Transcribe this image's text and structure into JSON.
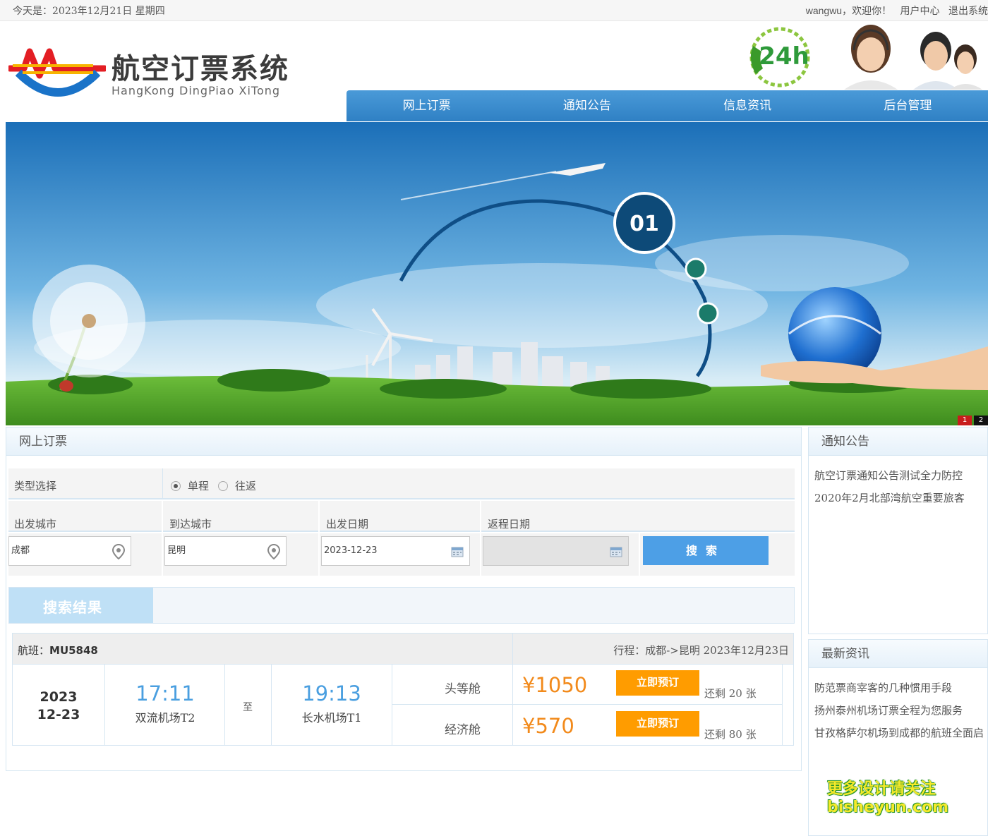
{
  "topbar": {
    "date_text": "今天是：2023年12月21日 星期四",
    "username": "wangwu，",
    "welcome": "欢迎你！",
    "user_center": "用户中心",
    "logout": "退出系统"
  },
  "brand": {
    "title": "航空订票系统",
    "subtitle": "HangKong DingPiao XiTong",
    "badge_text": "24h"
  },
  "nav": {
    "items": [
      "网上订票",
      "通知公告",
      "信息资讯",
      "后台管理"
    ]
  },
  "banner": {
    "slide_label": "01",
    "pager": [
      "1",
      "2"
    ]
  },
  "booking": {
    "panel_title": "网上订票",
    "type_label": "类型选择",
    "trip_types": [
      {
        "label": "单程",
        "selected": true
      },
      {
        "label": "往返",
        "selected": false
      }
    ],
    "depart_city_label": "出发城市",
    "arrive_city_label": "到达城市",
    "depart_date_label": "出发日期",
    "return_date_label": "返程日期",
    "depart_city_value": "成都",
    "arrive_city_value": "昆明",
    "depart_date_value": "2023-12-23",
    "return_date_value": "",
    "search_label": "搜索"
  },
  "results": {
    "tab_label": "搜索结果",
    "flight": {
      "flight_label": "航班：",
      "flight_no": "MU5848",
      "route_text": "行程：成都->昆明 2023年12月23日",
      "date_year": "2023",
      "date_md": "12-23",
      "depart_time": "17:11",
      "depart_airport": "双流机场T2",
      "to_label": "至",
      "arrive_time": "19:13",
      "arrive_airport": "长水机场T1",
      "cabins": [
        {
          "name": "头等舱",
          "price": "¥1050",
          "book_label": "立即预订",
          "remain": "还剩 20 张"
        },
        {
          "name": "经济舱",
          "price": "¥570",
          "book_label": "立即预订",
          "remain": "还剩 80 张"
        }
      ]
    }
  },
  "notices": {
    "title": "通知公告",
    "items": [
      "航空订票通知公告测试全力防控",
      "2020年2月北部湾航空重要旅客"
    ]
  },
  "news": {
    "title": "最新资讯",
    "items": [
      "防范票商宰客的几种惯用手段",
      "扬州泰州机场订票全程为您服务",
      "甘孜格萨尔机场到成都的航班全面启"
    ]
  },
  "watermark": {
    "line1": "更多设计请关注",
    "line2": "bisheyun.com"
  },
  "colors": {
    "nav_blue": "#2f80c4",
    "search_blue": "#4d9fe6",
    "book_orange": "#ff9c00",
    "price_orange": "#f28a1b",
    "time_blue": "#4a9fe0"
  }
}
